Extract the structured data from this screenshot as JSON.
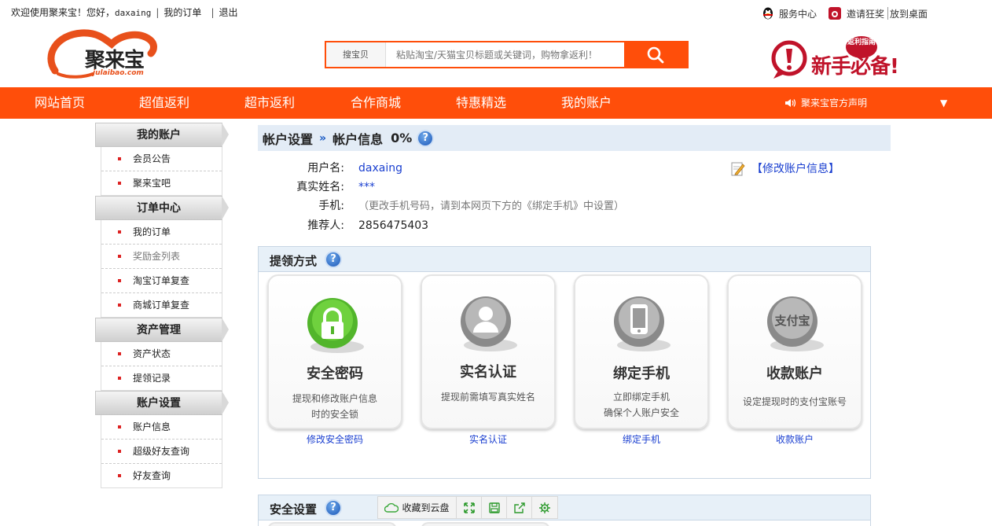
{
  "topbar": {
    "welcome": "欢迎使用聚来宝！您好，",
    "username": "daxaing",
    "my_orders": "我的订单",
    "logout": "退出",
    "service": "服务中心",
    "invite": "邀请狂奖",
    "desktop": "放到桌面"
  },
  "header": {
    "logo_text": "聚来宝",
    "logo_sub": "julaibao.com",
    "search_category": "搜宝贝",
    "search_placeholder": "粘贴淘宝/天猫宝贝标题或关键词，购物拿返利！",
    "newbie_text": "新手必备!",
    "newbie_badge": "返利指南"
  },
  "nav": {
    "items": [
      "网站首页",
      "超值返利",
      "超市返利",
      "合作商城",
      "特惠精选",
      "我的账户"
    ],
    "notice": "聚来宝官方声明",
    "arrow": "▼"
  },
  "sidebar": [
    {
      "title": "我的账户",
      "items": [
        "会员公告",
        "聚来宝吧"
      ]
    },
    {
      "title": "订单中心",
      "items": [
        "我的订单",
        "奖励金列表",
        "淘宝订单复查",
        "商城订单复查"
      ]
    },
    {
      "title": "资产管理",
      "items": [
        "资产状态",
        "提领记录"
      ]
    },
    {
      "title": "账户设置",
      "items": [
        "账户信息",
        "超级好友查询",
        "好友查询"
      ]
    }
  ],
  "main": {
    "breadcrumb_1": "帐户设置",
    "breadcrumb_sep": "»",
    "breadcrumb_2": "帐户信息",
    "percent": "0%",
    "help": "?",
    "fields": {
      "username_label": "用户名:",
      "username_value": "daxaing",
      "realname_label": "真实姓名:",
      "realname_value": "***",
      "phone_label": "手机:",
      "phone_value": "（更改手机号码，请到本网页下方的《绑定手机》中设置）",
      "referrer_label": "推荐人:",
      "referrer_value": "2856475403"
    },
    "edit_link": "【修改账户信息】"
  },
  "withdraw": {
    "title": "提领方式",
    "cards": [
      {
        "title": "安全密码",
        "desc1": "提现和修改账户信息",
        "desc2": "时的安全锁",
        "link": "修改安全密码"
      },
      {
        "title": "实名认证",
        "desc1": "提现前需填写真实姓名",
        "desc2": "",
        "link": "实名认证"
      },
      {
        "title": "绑定手机",
        "desc1": "立即绑定手机",
        "desc2": "确保个人账户安全",
        "link": "绑定手机"
      },
      {
        "title": "收款账户",
        "desc1": "设定提现时的支付宝账号",
        "desc2": "",
        "link": "收款账户"
      }
    ],
    "alipay_glyph": "支付宝"
  },
  "security": {
    "title": "安全设置",
    "cloud_save": "收藏到云盘"
  },
  "colors": {
    "accent": "#ff4e0a",
    "link": "#1a3fd0",
    "nav_bg": "#ff4e0a",
    "panel_head": "#e7f0f8"
  }
}
